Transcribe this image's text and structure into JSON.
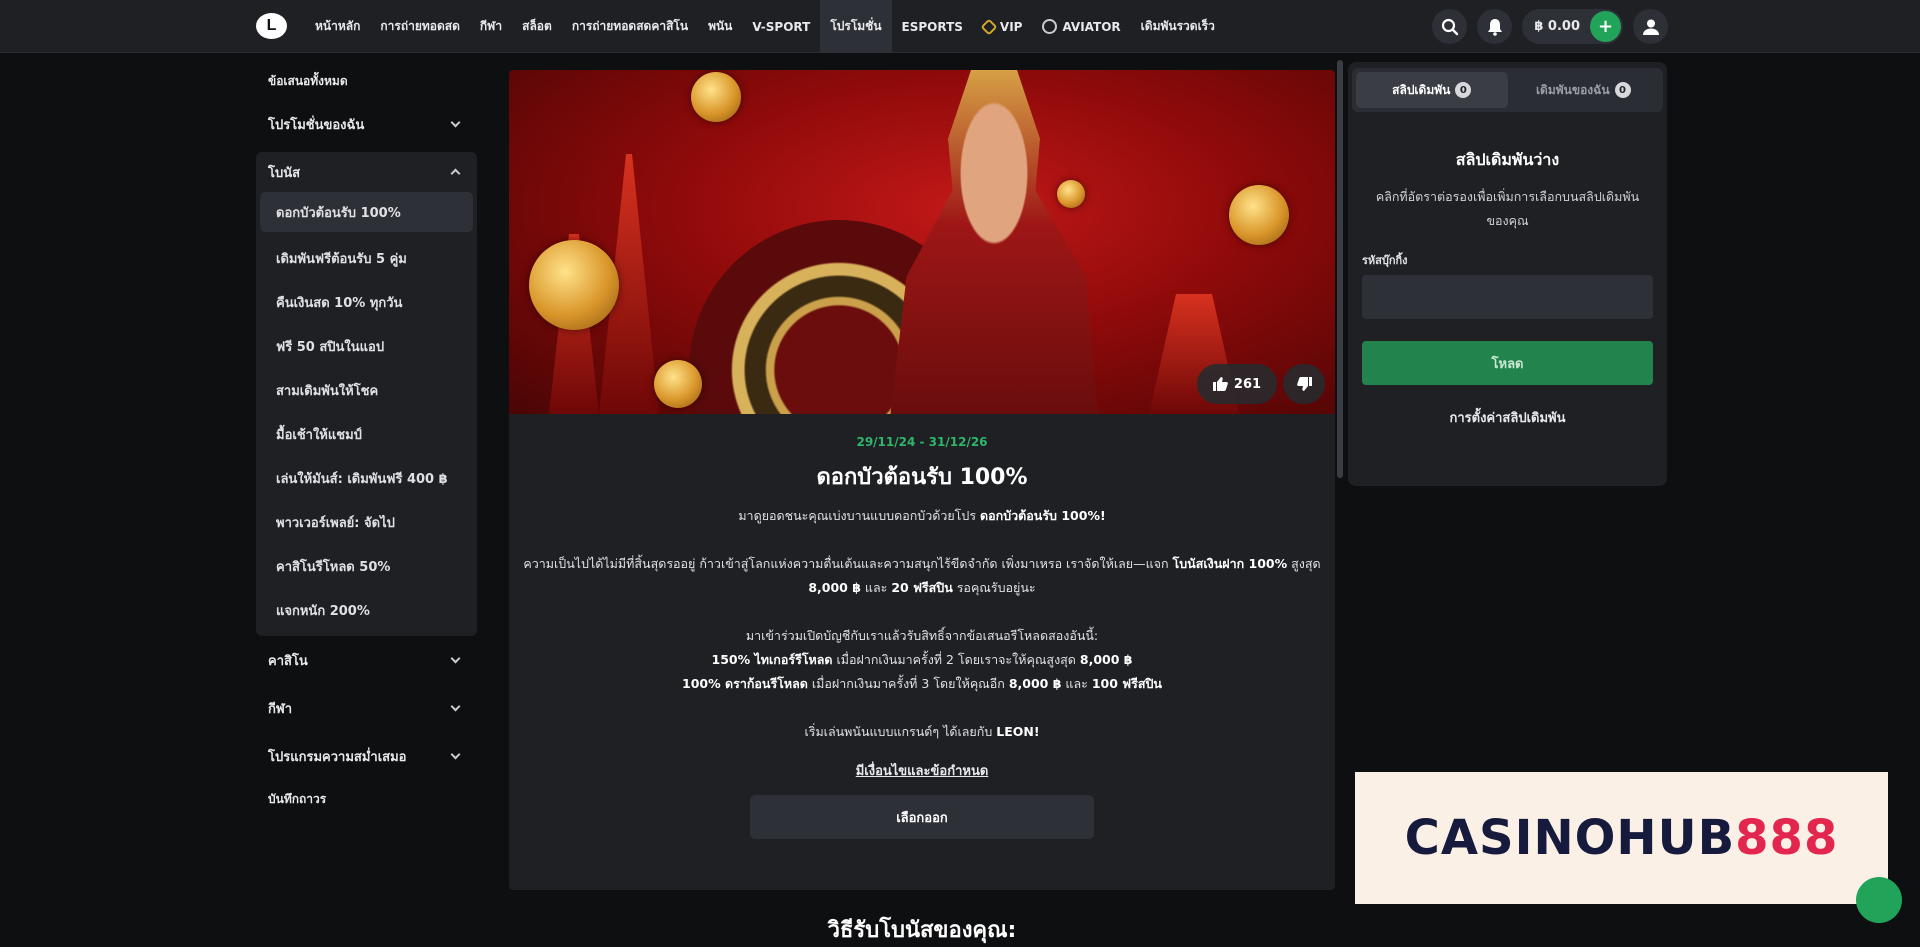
{
  "header": {
    "logo": "L",
    "nav": [
      {
        "label": "หน้าหลัก",
        "icon": ""
      },
      {
        "label": "การถ่ายทอดสด",
        "icon": ""
      },
      {
        "label": "กีฬา",
        "icon": ""
      },
      {
        "label": "สล็อต",
        "icon": ""
      },
      {
        "label": "การถ่ายทอดสดคาสิโน",
        "icon": ""
      },
      {
        "label": "พนัน",
        "icon": ""
      },
      {
        "label": "V-SPORT",
        "icon": ""
      },
      {
        "label": "โปรโมชั่น",
        "icon": "",
        "active": true
      },
      {
        "label": "ESPORTS",
        "icon": ""
      },
      {
        "label": "VIP",
        "icon": "vip-crown-icon"
      },
      {
        "label": "AVIATOR",
        "icon": "aviator-icon"
      },
      {
        "label": "เดิมพันรวดเร็ว",
        "icon": ""
      }
    ],
    "balance": "฿ 0.00",
    "plus": "+"
  },
  "sidebar": {
    "all_offers": "ข้อเสนอทั้งหมด",
    "my_promotions": "โปรโมชั่นของฉัน",
    "bonus_group": "โบนัส",
    "bonus_items": [
      "ดอกบัวต้อนรับ 100%",
      "เดิมพันฟรีต้อนรับ 5 คู่ม",
      "คืนเงินสด 10% ทุกวัน",
      "ฟรี 50 สปินในแอป",
      "สามเดิมพันให้โชค",
      "มื้อเช้าให้แชมป์",
      "เล่นให้มันส์: เดิมพันฟรี 400 ฿",
      "พาวเวอร์เพลย์: จัดไป",
      "คาสิโนรีโหลด 50%",
      "แจกหนัก 200%"
    ],
    "groups": [
      "คาสิโน",
      "กีฬา",
      "โปรแกรมความสม่ำเสมอ"
    ],
    "archive": "บันทึกถาวร"
  },
  "promo": {
    "likes": "261",
    "date": "29/11/24 - 31/12/26",
    "title": "ดอกบัวต้อนรับ 100%",
    "p1_text": "มาดูยอดชนะคุณเบ่งบานแบบดอกบัวด้วยโปร ",
    "p1_bold": "ดอกบัวต้อนรับ 100%!",
    "p2_a": "ความเป็นไปได้ไม่มีที่สิ้นสุดรออยู่ ก้าวเข้าสู่โลกแห่งความตื่นเต้นและความสนุกไร้ขีดจำกัด เพิ่งมาเหรอ เราจัดให้เลย—แจก ",
    "p2_b": "โบนัสเงินฝาก 100%",
    "p2_c": " สูงสุด ",
    "p2_d": "8,000 ฿",
    "p2_e": " และ ",
    "p2_f": "20 ฟรีสปิน",
    "p2_g": " รอคุณรับอยู่นะ",
    "p3": "มาเข้าร่วมเปิดบัญชีกับเราแล้วรับสิทธิ์จากข้อเสนอรีโหลดสองอันนี้:",
    "l1_b": "150% ไทเกอร์รีโหลด",
    "l1_t": " เมื่อฝากเงินมาครั้งที่ 2 โดยเราจะให้คุณสูงสุด ",
    "l1_amt": "8,000 ฿",
    "l2_b": "100% ดราก้อนรีโหลด",
    "l2_t": " เมื่อฝากเงินมาครั้งที่ 3 โดยให้คุณอีก ",
    "l2_amt": "8,000 ฿",
    "l2_and": " และ ",
    "l2_spins": "100 ฟรีสปิน",
    "p4_t": "เริ่มเล่นพนันแบบแกรนด์ๆ ได้เลยกับ ",
    "p4_b": "LEON!",
    "terms": "มีเงื่อนไขและข้อกำหนด",
    "choose": "เลือกออก",
    "how_to": "วิธีรับโบนัสของคุณ:"
  },
  "betslip": {
    "tab1": "สลิปเดิมพัน",
    "tab1_count": "0",
    "tab2": "เดิมพันของฉัน",
    "tab2_count": "0",
    "empty_title": "สลิปเดิมพันว่าง",
    "empty_sub": "คลิกที่อัตราต่อรองเพื่อเพิ่มการเลือกบนสลิปเดิมพันของคุณ",
    "code_label": "รหัสบุ๊กกิ้ง",
    "load": "โหลด",
    "settings": "การตั้งค่าสลิปเดิมพัน"
  },
  "ad": {
    "text": "CASINOHUB",
    "num": "888"
  },
  "colors": {
    "accent_green": "#22a35a",
    "date_green": "#2fb66a",
    "panel": "#1e2024",
    "background": "#0e0f11"
  }
}
